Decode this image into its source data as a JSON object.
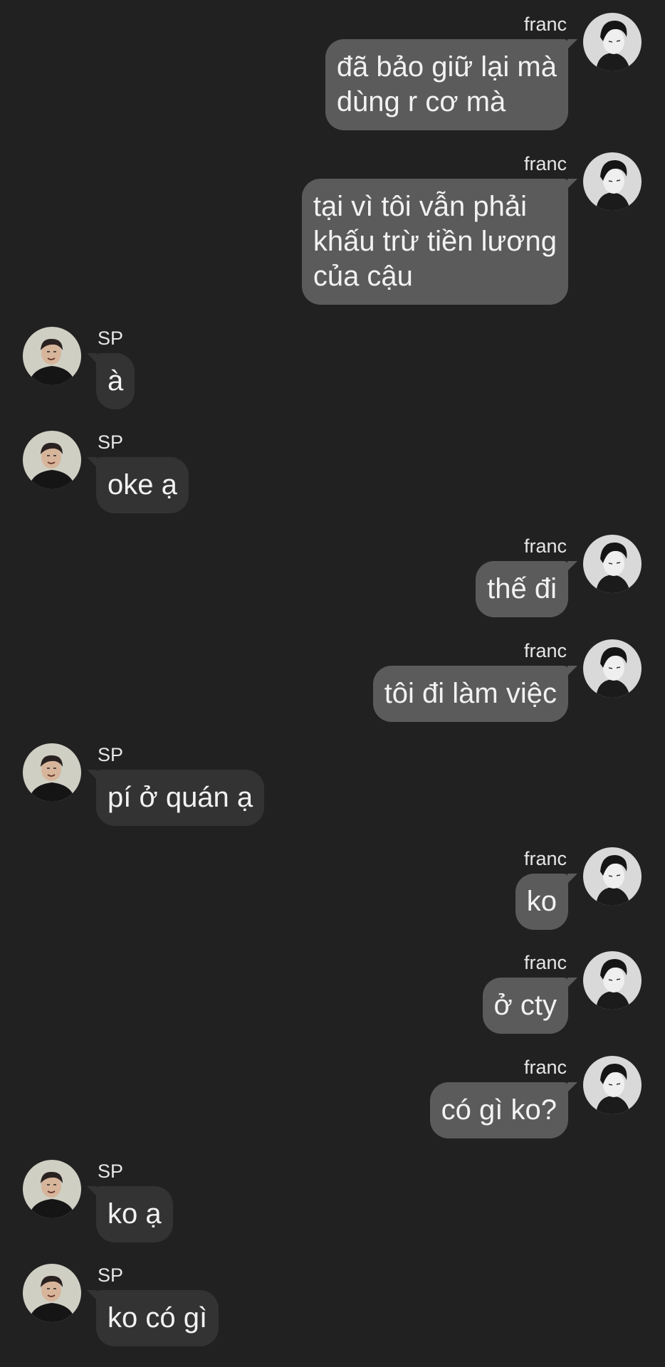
{
  "messages": [
    {
      "sender": "franc",
      "text": "đã bảo giữ lại mà\ndùng r cơ mà"
    },
    {
      "sender": "franc",
      "text": "tại vì tôi vẫn phải\nkhấu trừ tiền lương\ncủa cậu"
    },
    {
      "sender": "SP",
      "text": "à"
    },
    {
      "sender": "SP",
      "text": "oke ạ"
    },
    {
      "sender": "franc",
      "text": "thế đi"
    },
    {
      "sender": "franc",
      "text": "tôi đi làm việc"
    },
    {
      "sender": "SP",
      "text": "pí ở quán ạ"
    },
    {
      "sender": "franc",
      "text": "ko"
    },
    {
      "sender": "franc",
      "text": "ở cty"
    },
    {
      "sender": "franc",
      "text": "có gì ko?"
    },
    {
      "sender": "SP",
      "text": "ko ạ"
    },
    {
      "sender": "SP",
      "text": "ko có gì"
    }
  ]
}
